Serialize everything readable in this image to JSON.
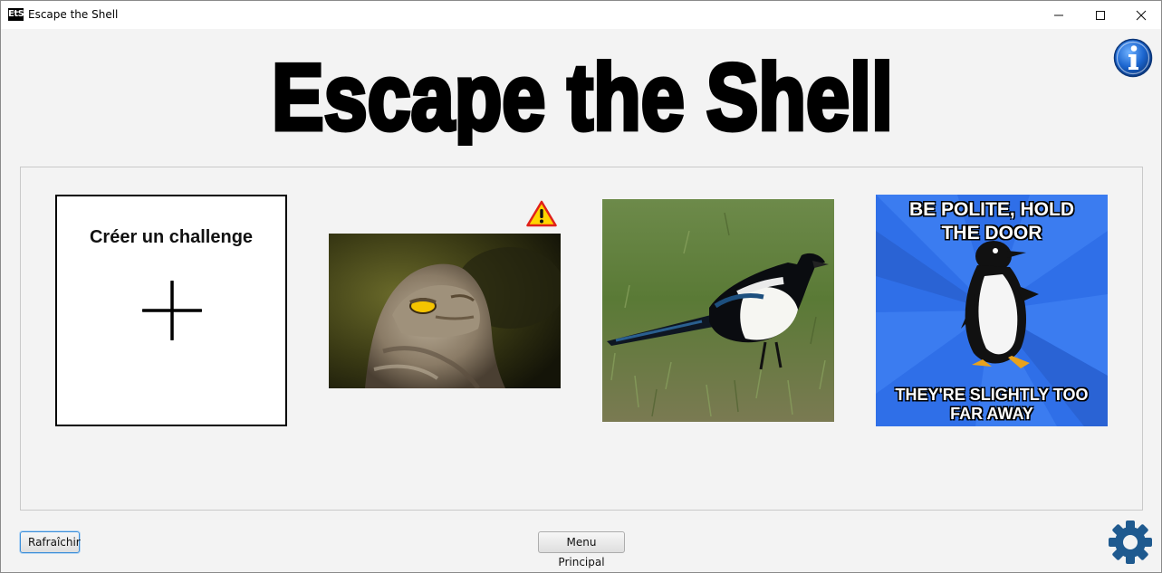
{
  "window": {
    "title": "Escape the Shell",
    "app_icon_text": "EtS",
    "controls": [
      "minimize-icon",
      "maximize-icon",
      "close-icon"
    ]
  },
  "header": {
    "logo_text": "Escape the Shell",
    "info_icon": "info-icon"
  },
  "challenges": {
    "create_card": {
      "label": "Créer un challenge",
      "icon": "plus-icon"
    },
    "items": [
      {
        "image": "frogmouth-bird-photo",
        "warning_icon": "warning-icon"
      },
      {
        "image": "magpie-photo"
      },
      {
        "image": "socially-awkward-penguin-meme",
        "caption_top": [
          "BE POLITE, HOLD",
          "THE DOOR"
        ],
        "caption_bottom": [
          "THEY'RE SLIGHTLY TOO",
          "FAR AWAY"
        ]
      }
    ]
  },
  "footer": {
    "refresh_label": "Rafraîchir",
    "main_menu_label": "Menu Principal",
    "settings_icon": "gear-icon"
  },
  "colors": {
    "background": "#f3f3f3",
    "info_blue": "#1a5fb4",
    "gear_blue": "#1f5a8f",
    "warning_yellow": "#ffd400",
    "warning_red": "#e0201b",
    "meme_blue": "#2f6fe8"
  }
}
